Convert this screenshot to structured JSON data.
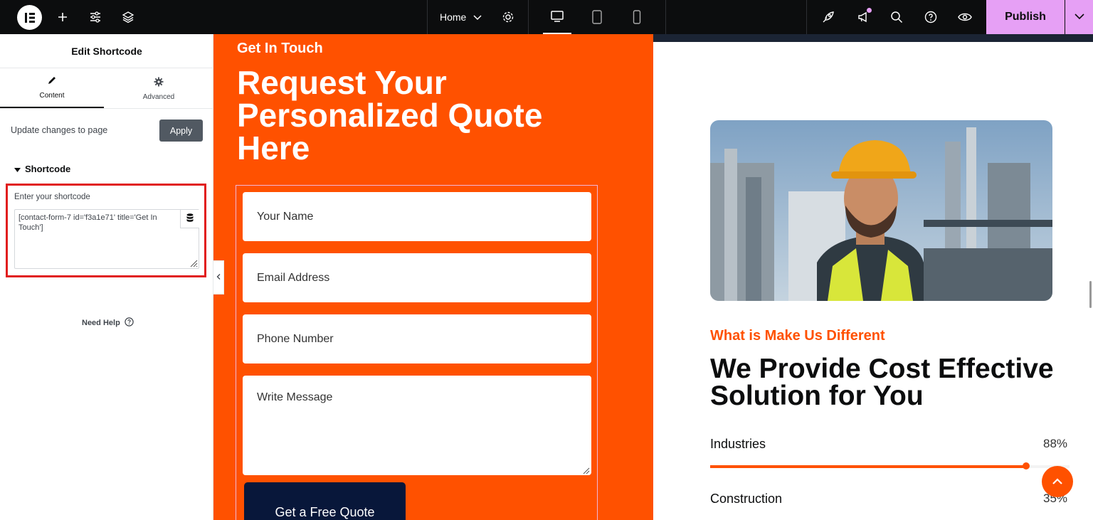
{
  "topbar": {
    "page_selector": "Home",
    "publish_label": "Publish",
    "publish_color": "#e6a0f5",
    "icons": [
      "elementor-logo-icon",
      "add-icon",
      "settings-sliders-icon",
      "layers-icon",
      "chevron-down-icon",
      "gear-icon",
      "desktop-icon",
      "tablet-icon",
      "mobile-icon",
      "rocket-icon",
      "megaphone-icon",
      "search-icon",
      "help-icon",
      "eye-icon"
    ]
  },
  "panel": {
    "title": "Edit Shortcode",
    "tabs": [
      {
        "label": "Content",
        "icon": "pencil-icon"
      },
      {
        "label": "Advanced",
        "icon": "gear-icon"
      }
    ],
    "update_text": "Update changes to page",
    "apply_label": "Apply",
    "section_title": "Shortcode",
    "shortcode_label": "Enter your shortcode",
    "shortcode_value": "[contact-form-7 id='f3a1e71' title='Get In Touch']",
    "need_help": "Need Help",
    "highlight_color": "#e11d1d"
  },
  "canvas": {
    "contact": {
      "eyebrow": "Get In Touch",
      "title": "Request Your Personalized Quote Here",
      "fields": [
        "Your Name",
        "Email Address",
        "Phone Number",
        "Write Message"
      ],
      "submit": "Get a Free Quote",
      "bg_color": "#ff5100"
    },
    "about": {
      "eyebrow": "What is Make Us Different",
      "title": "We Provide Cost Effective Solution for You",
      "skills": [
        {
          "name": "Industries",
          "pct_label": "88%",
          "value": 88
        },
        {
          "name": "Construction",
          "pct_label": "35%",
          "value": 35
        }
      ]
    }
  }
}
